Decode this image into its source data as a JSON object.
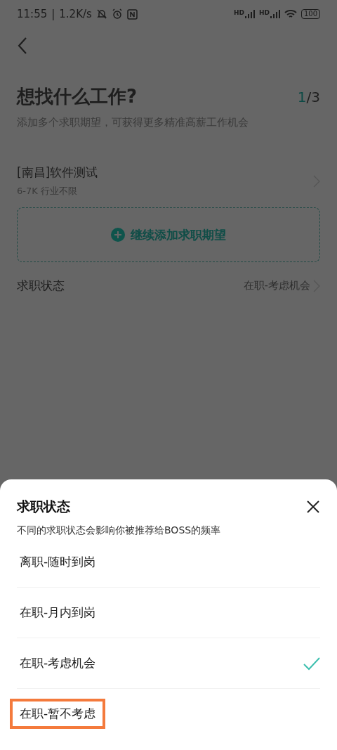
{
  "status_bar": {
    "time": "11:55",
    "separator": "|",
    "speed": "1.2K/s",
    "signals": [
      {
        "label": "HD"
      },
      {
        "label": "HD"
      }
    ],
    "battery": "100"
  },
  "page": {
    "title": "想找什么工作?",
    "step_current": "1",
    "step_total": "/3",
    "subtitle": "添加多个求职期望，可获得更多精准高薪工作机会",
    "expectations": [
      {
        "title": "[南昌]软件测试",
        "detail": "6-7K 行业不限"
      }
    ],
    "add_button": "继续添加求职期望",
    "status_row": {
      "label": "求职状态",
      "value": "在职-考虑机会"
    }
  },
  "sheet": {
    "title": "求职状态",
    "subtitle": "不同的求职状态会影响你被推荐给BOSS的频率",
    "options": [
      {
        "label": "离职-随时到岗",
        "selected": false,
        "highlighted": false
      },
      {
        "label": "在职-月内到岗",
        "selected": false,
        "highlighted": false
      },
      {
        "label": "在职-考虑机会",
        "selected": true,
        "highlighted": false
      },
      {
        "label": "在职-暂不考虑",
        "selected": false,
        "highlighted": true
      }
    ]
  }
}
